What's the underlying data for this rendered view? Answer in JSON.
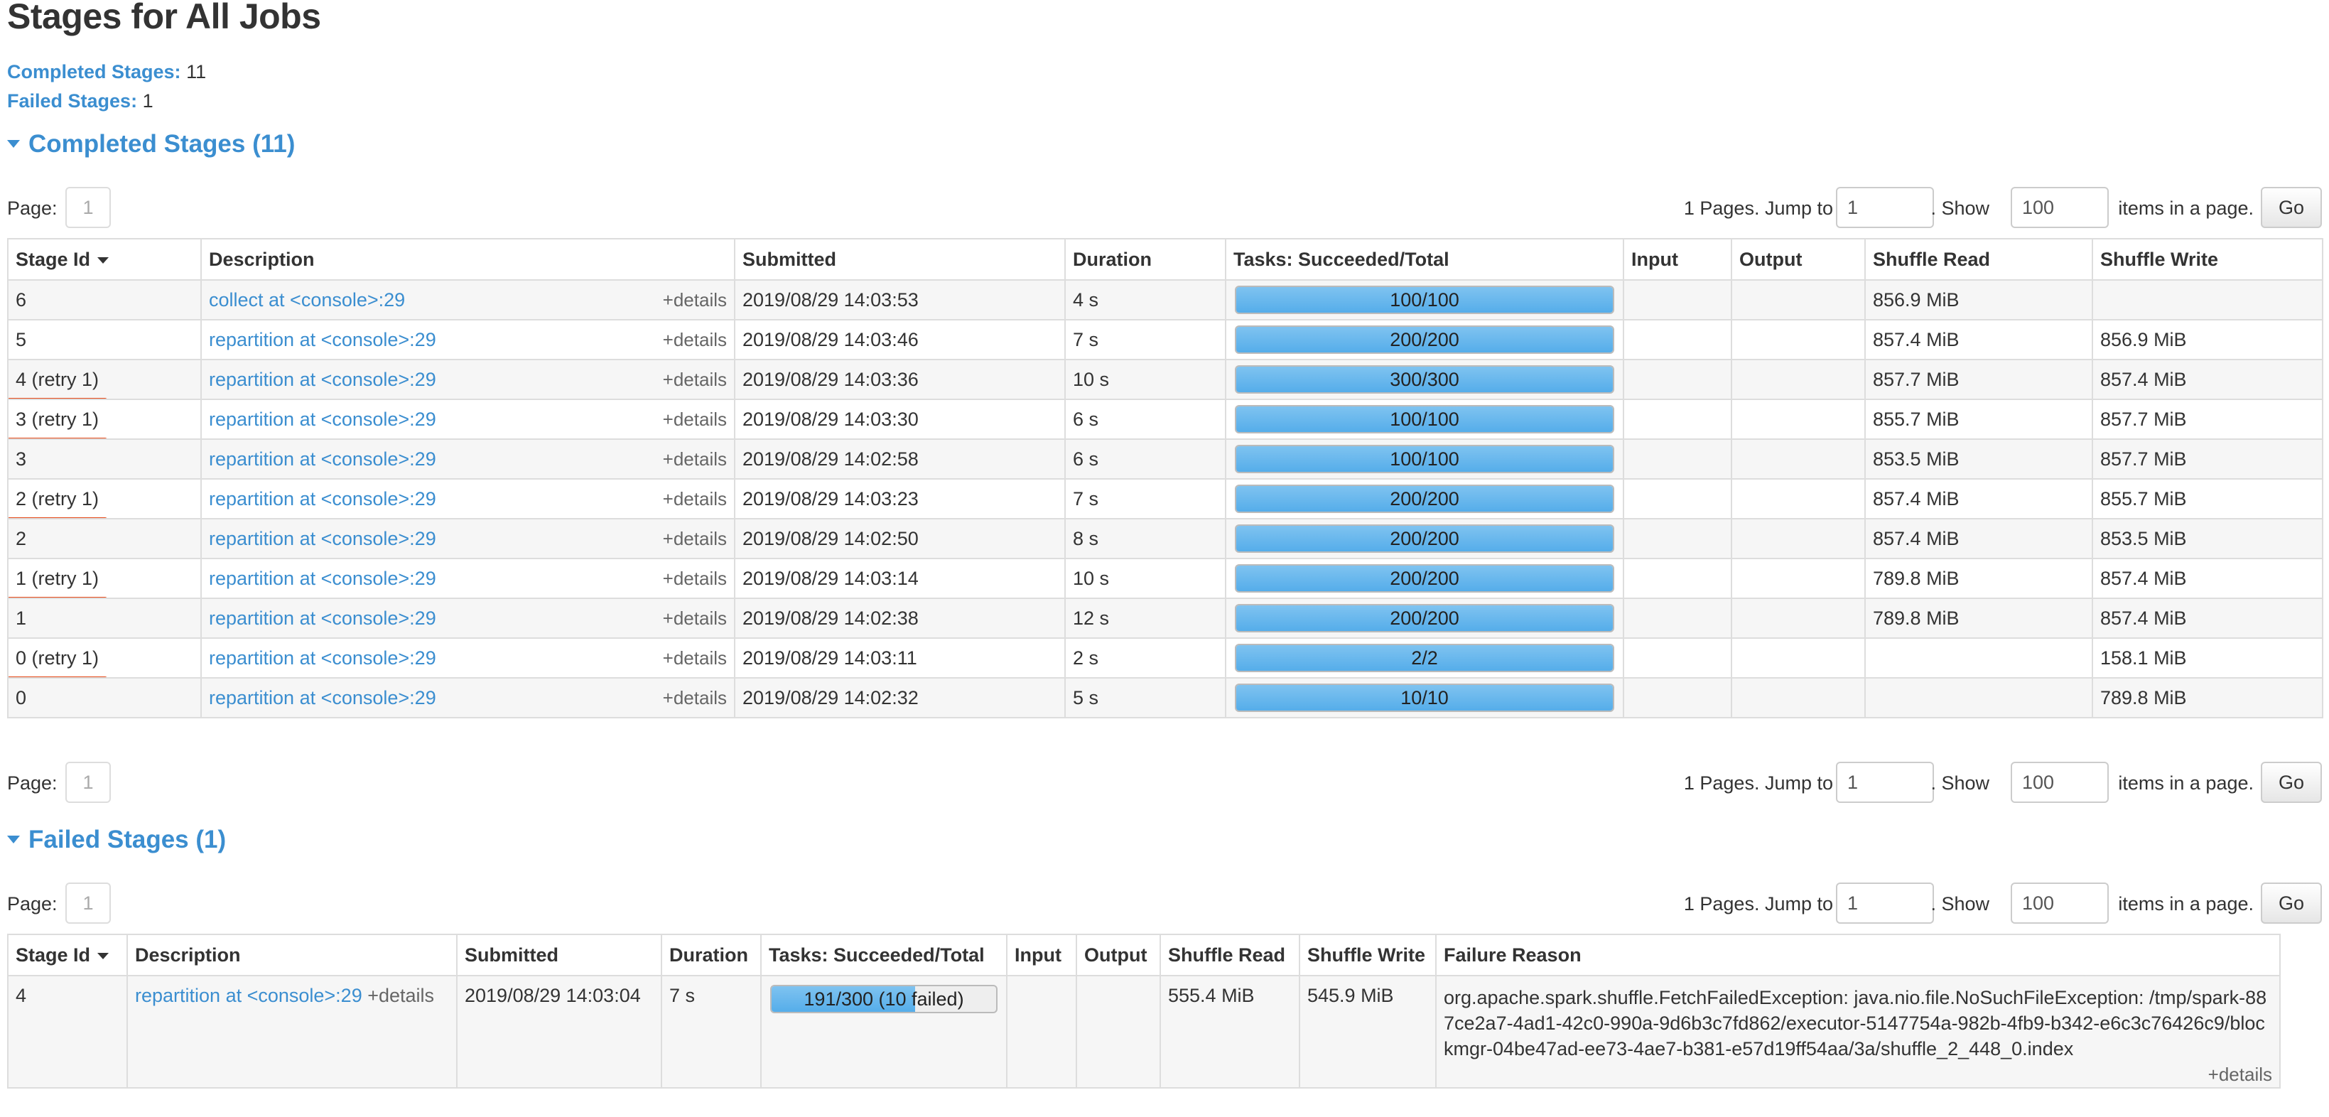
{
  "page": {
    "title": "Stages for All Jobs"
  },
  "summary": {
    "completed_label": "Completed Stages:",
    "completed_value": "11",
    "failed_label": "Failed Stages:",
    "failed_value": "1"
  },
  "pager": {
    "page_label": "Page:",
    "page_value": "1",
    "pages_text": "1 Pages. Jump to",
    "jump_value": "1",
    "show_text": ". Show",
    "show_value": "100",
    "items_text": "items in a page.",
    "go_label": "Go"
  },
  "completed": {
    "header": "Completed Stages (11)",
    "columns": [
      "Stage Id",
      "Description",
      "Submitted",
      "Duration",
      "Tasks: Succeeded/Total",
      "Input",
      "Output",
      "Shuffle Read",
      "Shuffle Write"
    ],
    "rows": [
      {
        "stage_id": "6",
        "retry": false,
        "description": "collect at <console>:29",
        "details": "+details",
        "submitted": "2019/08/29 14:03:53",
        "duration": "4 s",
        "tasks": "100/100",
        "progress": 1.0,
        "input": "",
        "output": "",
        "shuffle_read": "856.9 MiB",
        "shuffle_write": ""
      },
      {
        "stage_id": "5",
        "retry": false,
        "description": "repartition at <console>:29",
        "details": "+details",
        "submitted": "2019/08/29 14:03:46",
        "duration": "7 s",
        "tasks": "200/200",
        "progress": 1.0,
        "input": "",
        "output": "",
        "shuffle_read": "857.4 MiB",
        "shuffle_write": "856.9 MiB"
      },
      {
        "stage_id": "4 (retry 1)",
        "retry": true,
        "description": "repartition at <console>:29",
        "details": "+details",
        "submitted": "2019/08/29 14:03:36",
        "duration": "10 s",
        "tasks": "300/300",
        "progress": 1.0,
        "input": "",
        "output": "",
        "shuffle_read": "857.7 MiB",
        "shuffle_write": "857.4 MiB"
      },
      {
        "stage_id": "3 (retry 1)",
        "retry": true,
        "description": "repartition at <console>:29",
        "details": "+details",
        "submitted": "2019/08/29 14:03:30",
        "duration": "6 s",
        "tasks": "100/100",
        "progress": 1.0,
        "input": "",
        "output": "",
        "shuffle_read": "855.7 MiB",
        "shuffle_write": "857.7 MiB"
      },
      {
        "stage_id": "3",
        "retry": false,
        "description": "repartition at <console>:29",
        "details": "+details",
        "submitted": "2019/08/29 14:02:58",
        "duration": "6 s",
        "tasks": "100/100",
        "progress": 1.0,
        "input": "",
        "output": "",
        "shuffle_read": "853.5 MiB",
        "shuffle_write": "857.7 MiB"
      },
      {
        "stage_id": "2 (retry 1)",
        "retry": true,
        "description": "repartition at <console>:29",
        "details": "+details",
        "submitted": "2019/08/29 14:03:23",
        "duration": "7 s",
        "tasks": "200/200",
        "progress": 1.0,
        "input": "",
        "output": "",
        "shuffle_read": "857.4 MiB",
        "shuffle_write": "855.7 MiB"
      },
      {
        "stage_id": "2",
        "retry": false,
        "description": "repartition at <console>:29",
        "details": "+details",
        "submitted": "2019/08/29 14:02:50",
        "duration": "8 s",
        "tasks": "200/200",
        "progress": 1.0,
        "input": "",
        "output": "",
        "shuffle_read": "857.4 MiB",
        "shuffle_write": "853.5 MiB"
      },
      {
        "stage_id": "1 (retry 1)",
        "retry": true,
        "description": "repartition at <console>:29",
        "details": "+details",
        "submitted": "2019/08/29 14:03:14",
        "duration": "10 s",
        "tasks": "200/200",
        "progress": 1.0,
        "input": "",
        "output": "",
        "shuffle_read": "789.8 MiB",
        "shuffle_write": "857.4 MiB"
      },
      {
        "stage_id": "1",
        "retry": false,
        "description": "repartition at <console>:29",
        "details": "+details",
        "submitted": "2019/08/29 14:02:38",
        "duration": "12 s",
        "tasks": "200/200",
        "progress": 1.0,
        "input": "",
        "output": "",
        "shuffle_read": "789.8 MiB",
        "shuffle_write": "857.4 MiB"
      },
      {
        "stage_id": "0 (retry 1)",
        "retry": true,
        "description": "repartition at <console>:29",
        "details": "+details",
        "submitted": "2019/08/29 14:03:11",
        "duration": "2 s",
        "tasks": "2/2",
        "progress": 1.0,
        "input": "",
        "output": "",
        "shuffle_read": "",
        "shuffle_write": "158.1 MiB"
      },
      {
        "stage_id": "0",
        "retry": false,
        "description": "repartition at <console>:29",
        "details": "+details",
        "submitted": "2019/08/29 14:02:32",
        "duration": "5 s",
        "tasks": "10/10",
        "progress": 1.0,
        "input": "",
        "output": "",
        "shuffle_read": "",
        "shuffle_write": "789.8 MiB"
      }
    ]
  },
  "failed": {
    "header": "Failed Stages (1)",
    "columns": [
      "Stage Id",
      "Description",
      "Submitted",
      "Duration",
      "Tasks: Succeeded/Total",
      "Input",
      "Output",
      "Shuffle Read",
      "Shuffle Write",
      "Failure Reason"
    ],
    "rows": [
      {
        "stage_id": "4",
        "description": "repartition at <console>:29",
        "details": "+details",
        "submitted": "2019/08/29 14:03:04",
        "duration": "7 s",
        "tasks": "191/300 (10 failed)",
        "progress": 0.64,
        "input": "",
        "output": "",
        "shuffle_read": "555.4 MiB",
        "shuffle_write": "545.9 MiB",
        "failure_reason": "org.apache.spark.shuffle.FetchFailedException: java.nio.file.NoSuchFileException: /tmp/spark-887ce2a7-4ad1-42c0-990a-9d6b3c7fd862/executor-5147754a-982b-4fb9-b342-e6c3c76426c9/blockmgr-04be47ad-ee73-4ae7-b381-e57d19ff54aa/3a/shuffle_2_448_0.index",
        "failure_details": "+details"
      }
    ]
  }
}
